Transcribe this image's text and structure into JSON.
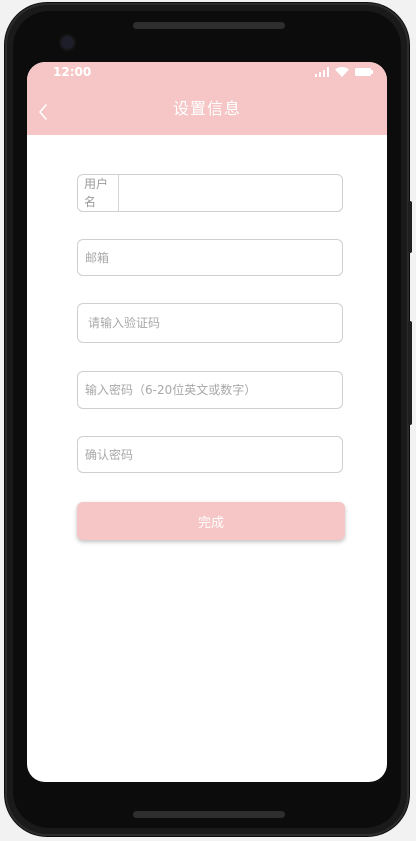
{
  "status_bar": {
    "time": "12:00",
    "icons": [
      "signal-icon",
      "wifi-icon",
      "battery-icon"
    ]
  },
  "header": {
    "title": "设置信息",
    "back_icon": "chevron-left-icon",
    "background": "#f6c6c6"
  },
  "form": {
    "username": {
      "label": "用户名",
      "value": "",
      "placeholder": ""
    },
    "email": {
      "value": "",
      "placeholder": "邮箱"
    },
    "verification_code": {
      "value": "",
      "placeholder": "请输入验证码"
    },
    "password": {
      "value": "",
      "placeholder": "输入密码（6-20位英文或数字）"
    },
    "confirm_password": {
      "value": "",
      "placeholder": "确认密码"
    }
  },
  "submit": {
    "label": "完成",
    "color": "#f6c6c6"
  }
}
